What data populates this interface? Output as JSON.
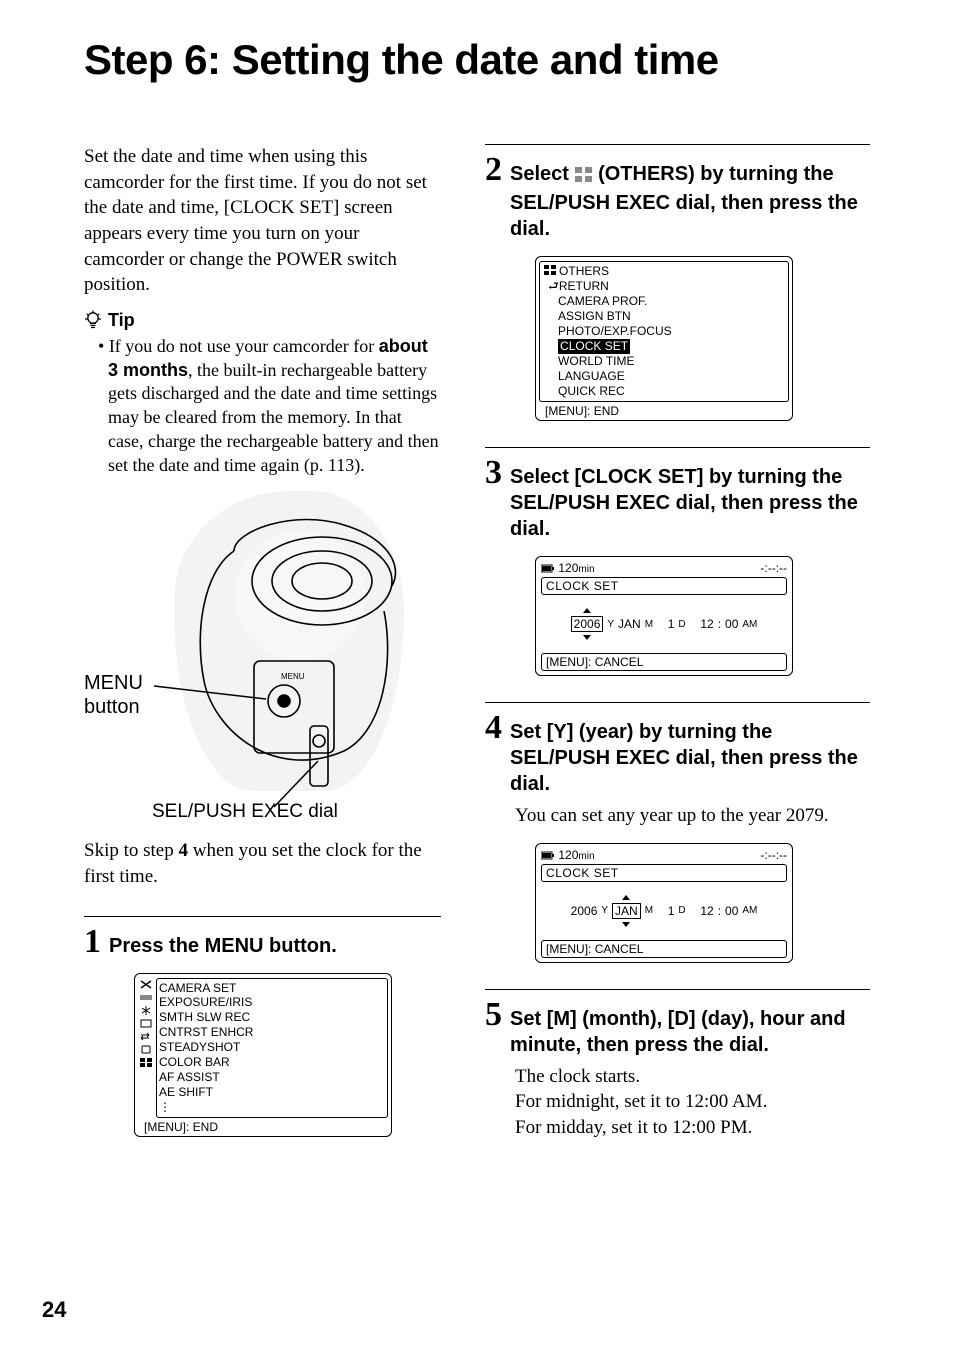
{
  "page_number": "24",
  "title": "Step 6: Setting the date and time",
  "intro": "Set the date and time when using this camcorder for the first time. If you do not set the date and time, [CLOCK SET] screen appears every time you turn on your camcorder or change the POWER switch position.",
  "tip_label": "Tip",
  "tip_bullet_prefix": "•",
  "tip_body_a": "If you do not use your camcorder for ",
  "tip_body_b": "about 3 months",
  "tip_body_c": ", the built-in rechargeable battery gets discharged and the date and time settings may be cleared from the memory. In that case, charge the rechargeable battery and then set the date and time again (p. 113).",
  "fig": {
    "menu_button_label": "MENU\nbutton",
    "sel_dial_label": "SEL/PUSH EXEC dial"
  },
  "skip_a": "Skip to step ",
  "skip_b": "4",
  "skip_c": " when you set the clock for the first time.",
  "steps": {
    "1": {
      "text": "Press the MENU button."
    },
    "2": {
      "text_a": "Select ",
      "text_b": " (OTHERS) by turning the SEL/PUSH EXEC dial, then press the dial."
    },
    "3": {
      "text": "Select [CLOCK SET] by turning the SEL/PUSH EXEC dial, then press the dial."
    },
    "4": {
      "text": "Set [Y] (year) by turning the SEL/PUSH EXEC dial, then press the dial.",
      "body": "You can set any year up to the year 2079."
    },
    "5": {
      "text": "Set [M] (month), [D] (day), hour and minute, then press the dial.",
      "body": "The clock starts.\nFor midnight, set it to 12:00 AM.\nFor midday, set it to 12:00 PM."
    }
  },
  "lcd_cameramenu": {
    "header": "CAMERA SET",
    "items": [
      "EXPOSURE/IRIS",
      "SMTH SLW REC",
      "CNTRST ENHCR",
      "STEADYSHOT",
      "COLOR BAR",
      "AF ASSIST",
      "AE SHIFT"
    ],
    "more": "⋮",
    "footer": "[MENU]: END"
  },
  "lcd_others": {
    "header": "OTHERS",
    "items": [
      "RETURN",
      "CAMERA PROF.",
      "ASSIGN BTN",
      "PHOTO/EXP.FOCUS",
      "CLOCK SET",
      "WORLD TIME",
      "LANGUAGE",
      "QUICK REC"
    ],
    "highlight_index": 4,
    "footer": "[MENU]: END"
  },
  "lcd_clock1": {
    "battery": "120",
    "battery_unit": "min",
    "time_stub": "-:--:--",
    "title": "CLOCK SET",
    "values": {
      "y": "2006",
      "y_lbl": "Y",
      "m": "JAN",
      "m_lbl": "M",
      "d": "1",
      "d_lbl": "D",
      "hh": "12",
      "mm": "00",
      "ampm": "AM"
    },
    "highlight_field": "y",
    "footer": "[MENU]: CANCEL"
  },
  "lcd_clock2": {
    "battery": "120",
    "battery_unit": "min",
    "time_stub": "-:--:--",
    "title": "CLOCK SET",
    "values": {
      "y": "2006",
      "y_lbl": "Y",
      "m": "JAN",
      "m_lbl": "M",
      "d": "1",
      "d_lbl": "D",
      "hh": "12",
      "mm": "00",
      "ampm": "AM"
    },
    "highlight_field": "m",
    "footer": "[MENU]: CANCEL"
  }
}
